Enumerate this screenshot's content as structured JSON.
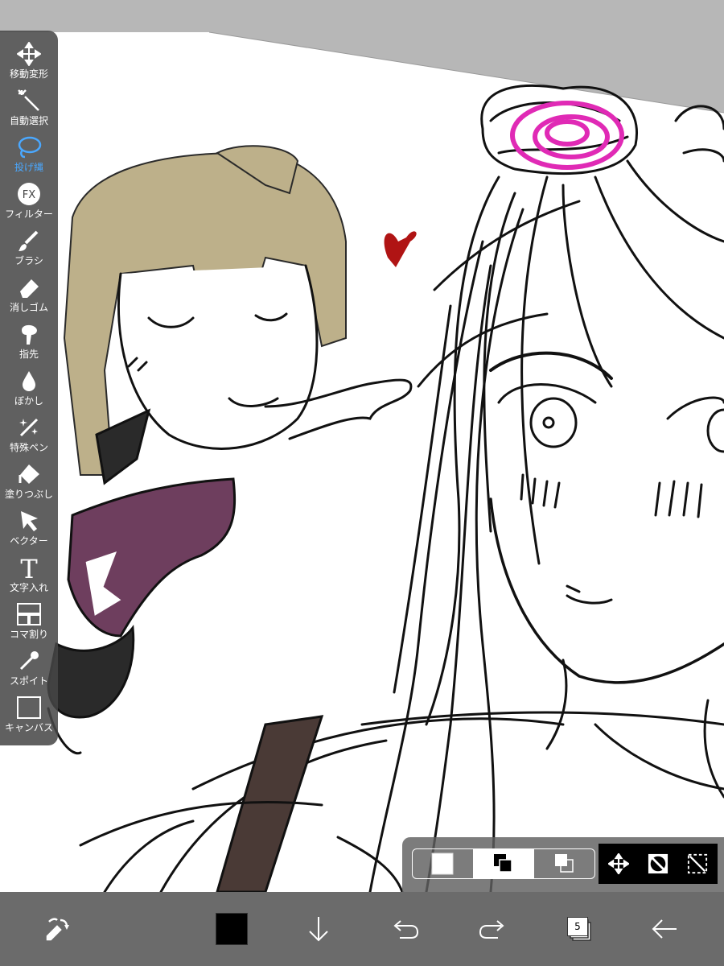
{
  "tools": [
    {
      "label": "移動変形",
      "icon": "move-arrows-icon",
      "active": false
    },
    {
      "label": "自動選択",
      "icon": "magic-wand-icon",
      "active": false
    },
    {
      "label": "投げ縄",
      "icon": "lasso-icon",
      "active": true
    },
    {
      "label": "フィルター",
      "icon": "fx-filter-icon",
      "active": false
    },
    {
      "label": "ブラシ",
      "icon": "brush-icon",
      "active": false
    },
    {
      "label": "消しゴム",
      "icon": "eraser-icon",
      "active": false
    },
    {
      "label": "指先",
      "icon": "finger-smudge-icon",
      "active": false
    },
    {
      "label": "ぼかし",
      "icon": "blur-drop-icon",
      "active": false
    },
    {
      "label": "特殊ペン",
      "icon": "special-pen-icon",
      "active": false
    },
    {
      "label": "塗りつぶし",
      "icon": "fill-bucket-icon",
      "active": false
    },
    {
      "label": "ベクター",
      "icon": "vector-cursor-icon",
      "active": false
    },
    {
      "label": "文字入れ",
      "icon": "text-t-icon",
      "active": false
    },
    {
      "label": "コマ割り",
      "icon": "panel-layout-icon",
      "active": false
    },
    {
      "label": "スポイト",
      "icon": "eyedropper-icon",
      "active": false
    },
    {
      "label": "キャンバス",
      "icon": "canvas-icon",
      "active": false
    }
  ],
  "filter_icon_text": "FX",
  "text_tool_glyph": "T",
  "selection_toolbar": {
    "modes": [
      "new-selection-icon",
      "add-selection-icon",
      "subtract-selection-icon"
    ],
    "selected_mode": 0,
    "actions": [
      "transform-move-icon",
      "invert-selection-icon",
      "clear-selection-icon"
    ]
  },
  "bottom_bar": {
    "current_color": "#000000",
    "layer_count": "5",
    "buttons": [
      "quick-action-icon",
      "color-swatch",
      "download-arrow-icon",
      "undo-icon",
      "redo-icon",
      "layers-icon",
      "back-arrow-icon"
    ]
  },
  "colors": {
    "accent": "#4aa8ff",
    "toolbar_bg": "#464646",
    "bottom_bar_bg": "#6b6b6b"
  }
}
